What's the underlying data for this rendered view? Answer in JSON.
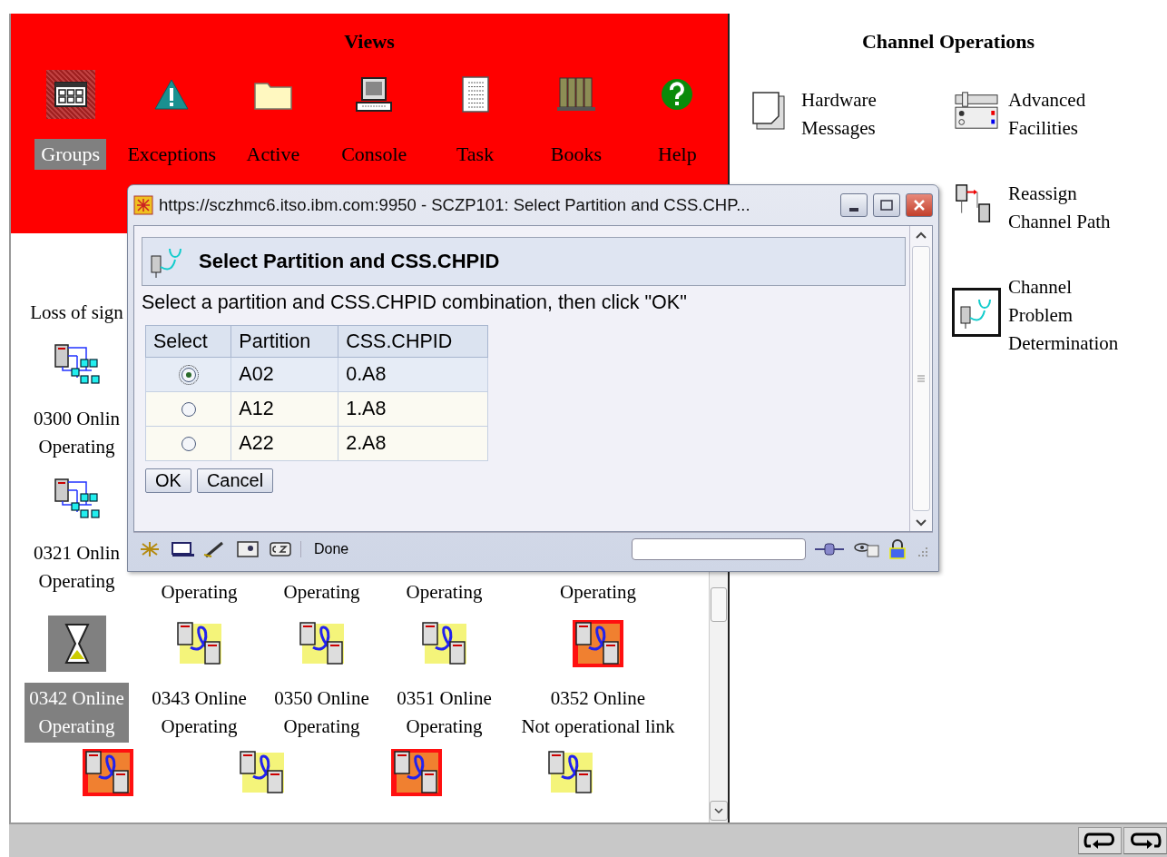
{
  "views": {
    "title": "Views",
    "items": [
      {
        "label": "Groups",
        "kind": "groups",
        "selected": true
      },
      {
        "label": "Exceptions",
        "kind": "warning",
        "selected": false
      },
      {
        "label": "Active",
        "kind": "folder",
        "selected": false
      },
      {
        "label": "Console",
        "kind": "computer",
        "selected": false
      },
      {
        "label": "Task",
        "kind": "list",
        "selected": false
      },
      {
        "label": "Books",
        "kind": "books",
        "selected": false
      },
      {
        "label": "Help",
        "kind": "help",
        "selected": false
      }
    ]
  },
  "channels": {
    "rows": [
      [
        {
          "kind": "text",
          "lines": [
            "Loss of sign"
          ]
        }
      ],
      [
        {
          "kind": "network",
          "lines": [
            "0300 Onlin",
            "Operating"
          ],
          "selected": false
        }
      ],
      [
        {
          "kind": "network",
          "lines": [
            "0321 Onlin",
            "Operating"
          ],
          "selected": false
        },
        {
          "kind": "covered",
          "lines": [
            "Operating"
          ]
        },
        {
          "kind": "covered",
          "lines": [
            "Operating"
          ]
        },
        {
          "kind": "covered",
          "lines": [
            "Operating"
          ]
        },
        {
          "kind": "covered",
          "lines": [
            "Operating"
          ]
        }
      ],
      [
        {
          "kind": "hourglass",
          "lines": [
            "0342 Online",
            "Operating"
          ],
          "selected": true
        },
        {
          "kind": "link-ok",
          "lines": [
            "0343 Online",
            "Operating"
          ],
          "selected": false
        },
        {
          "kind": "link-ok",
          "lines": [
            "0350 Online",
            "Operating"
          ],
          "selected": false
        },
        {
          "kind": "link-ok",
          "lines": [
            "0351 Online",
            "Operating"
          ],
          "selected": false
        },
        {
          "kind": "link-error",
          "lines": [
            "0352 Online",
            "Not operational link"
          ],
          "selected": false
        }
      ],
      [
        {
          "kind": "link-error"
        },
        {
          "kind": "link-ok"
        },
        {
          "kind": "link-error"
        },
        {
          "kind": "link-ok"
        }
      ]
    ]
  },
  "tasks": {
    "title": "Channel Operations",
    "items": [
      {
        "kind": "messages",
        "lines": [
          "Hardware",
          "Messages"
        ],
        "selected": false
      },
      {
        "kind": "facilities",
        "lines": [
          "Advanced",
          "Facilities"
        ],
        "selected": false
      },
      {
        "kind": "reassign",
        "lines": [
          "Reassign",
          "Channel Path"
        ],
        "selected": false
      },
      {
        "kind": "problem",
        "lines": [
          "Channel",
          "Problem",
          "Determination"
        ],
        "selected": true
      }
    ]
  },
  "dialog": {
    "title": "https://sczhmc6.itso.ibm.com:9950 - SCZP101: Select Partition and CSS.CHP...",
    "heading": "Select Partition and CSS.CHPID",
    "instruction": "Select a partition and CSS.CHPID combination, then click \"OK\"",
    "table": {
      "columns": [
        "Select",
        "Partition",
        "CSS.CHPID"
      ],
      "rows": [
        {
          "partition": "A02",
          "chpid": "0.A8",
          "selected": true
        },
        {
          "partition": "A12",
          "chpid": "1.A8",
          "selected": false
        },
        {
          "partition": "A22",
          "chpid": "2.A8",
          "selected": false
        }
      ]
    },
    "buttons": [
      "OK",
      "Cancel"
    ],
    "status": "Done"
  }
}
